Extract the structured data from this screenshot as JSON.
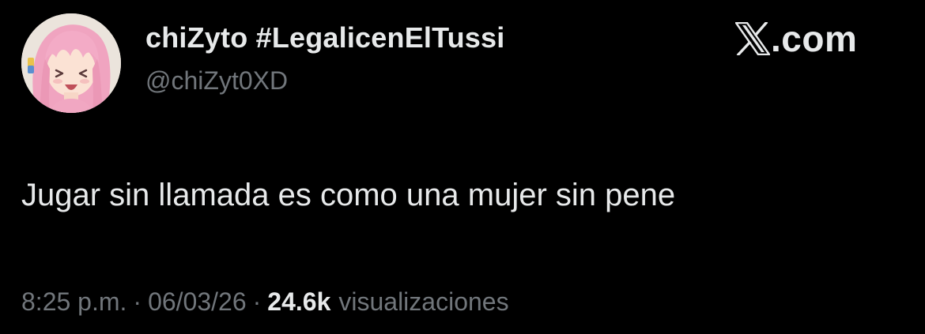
{
  "author": {
    "display_name": "chiZyto #LegalicenElTussi",
    "handle": "@chiZyt0XD",
    "avatar_icon": "anime-avatar-icon"
  },
  "brand": {
    "icon": "x-logo-icon",
    "text": ".com"
  },
  "tweet": {
    "text": "Jugar sin llamada es como una mujer sin pene"
  },
  "meta": {
    "time": "8:25 p.m.",
    "separator": "·",
    "date": "06/03/26",
    "views_count": "24.6k",
    "views_label": "visualizaciones"
  },
  "colors": {
    "background": "#000000",
    "primary_text": "#e7e9ea",
    "secondary_text": "#71767b"
  }
}
